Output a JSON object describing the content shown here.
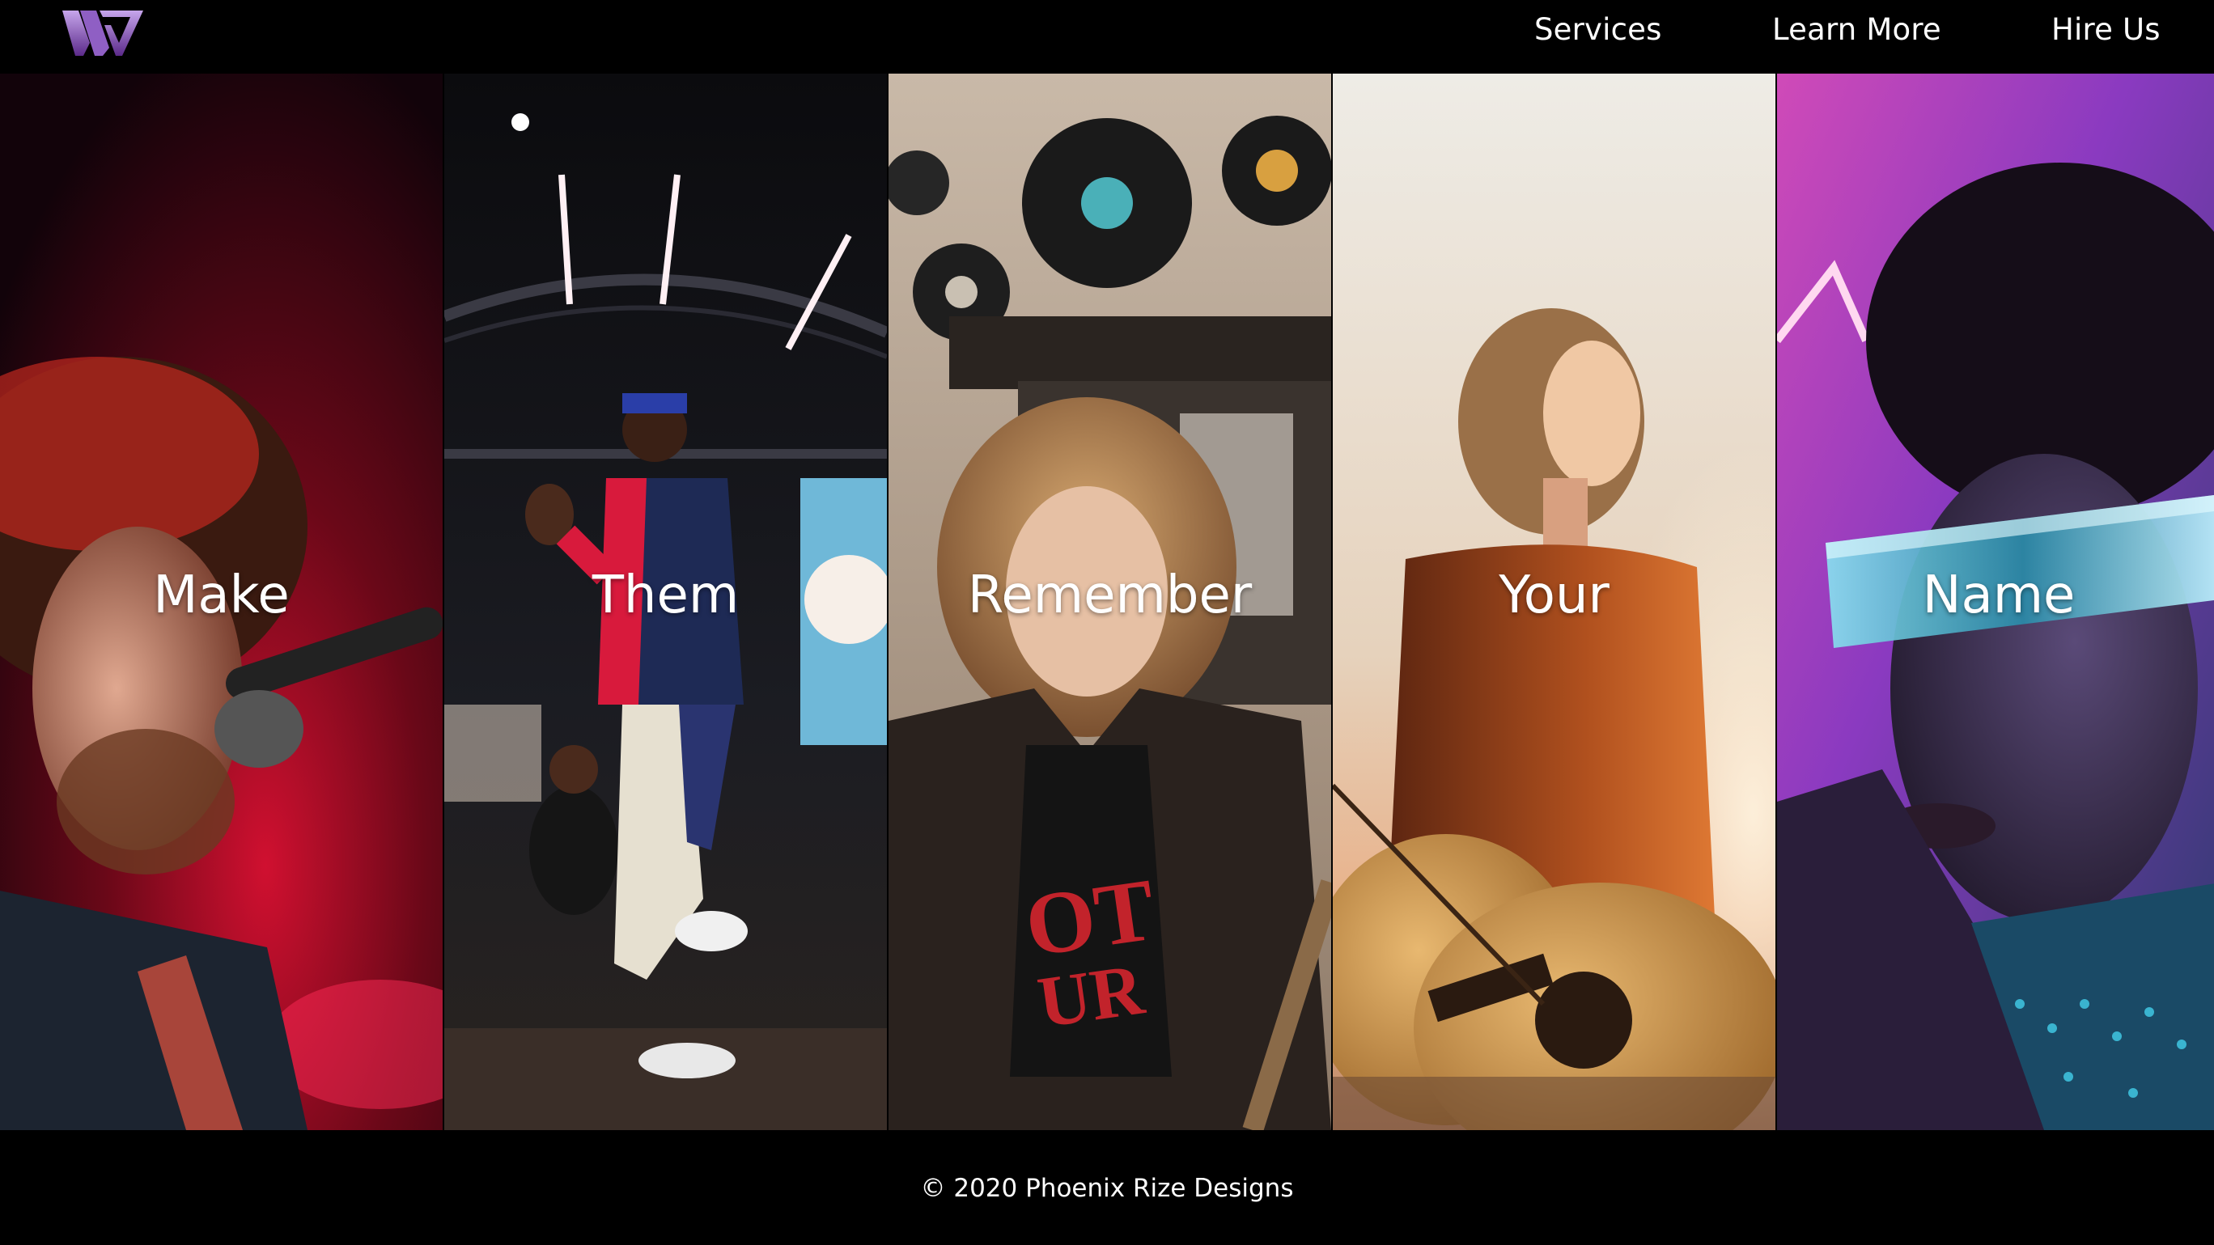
{
  "header": {
    "logo_name": "brand-logo",
    "nav": {
      "services": "Services",
      "learn_more": "Learn More",
      "hire_us": "Hire Us"
    }
  },
  "panels": [
    {
      "word": "Make",
      "photo": "singer-at-microphone"
    },
    {
      "word": "Them",
      "photo": "performer-on-stage"
    },
    {
      "word": "Remember",
      "photo": "woman-with-records-wall"
    },
    {
      "word": "Your",
      "photo": "woman-holding-guitar"
    },
    {
      "word": "Name",
      "photo": "man-with-visor-glasses"
    }
  ],
  "footer": {
    "copyright": "© 2020 Phoenix Rize Designs"
  },
  "colors": {
    "background": "#000000",
    "text": "#ffffff",
    "logo_gradient_start": "#b28ae0",
    "logo_gradient_end": "#5d2a8c"
  }
}
